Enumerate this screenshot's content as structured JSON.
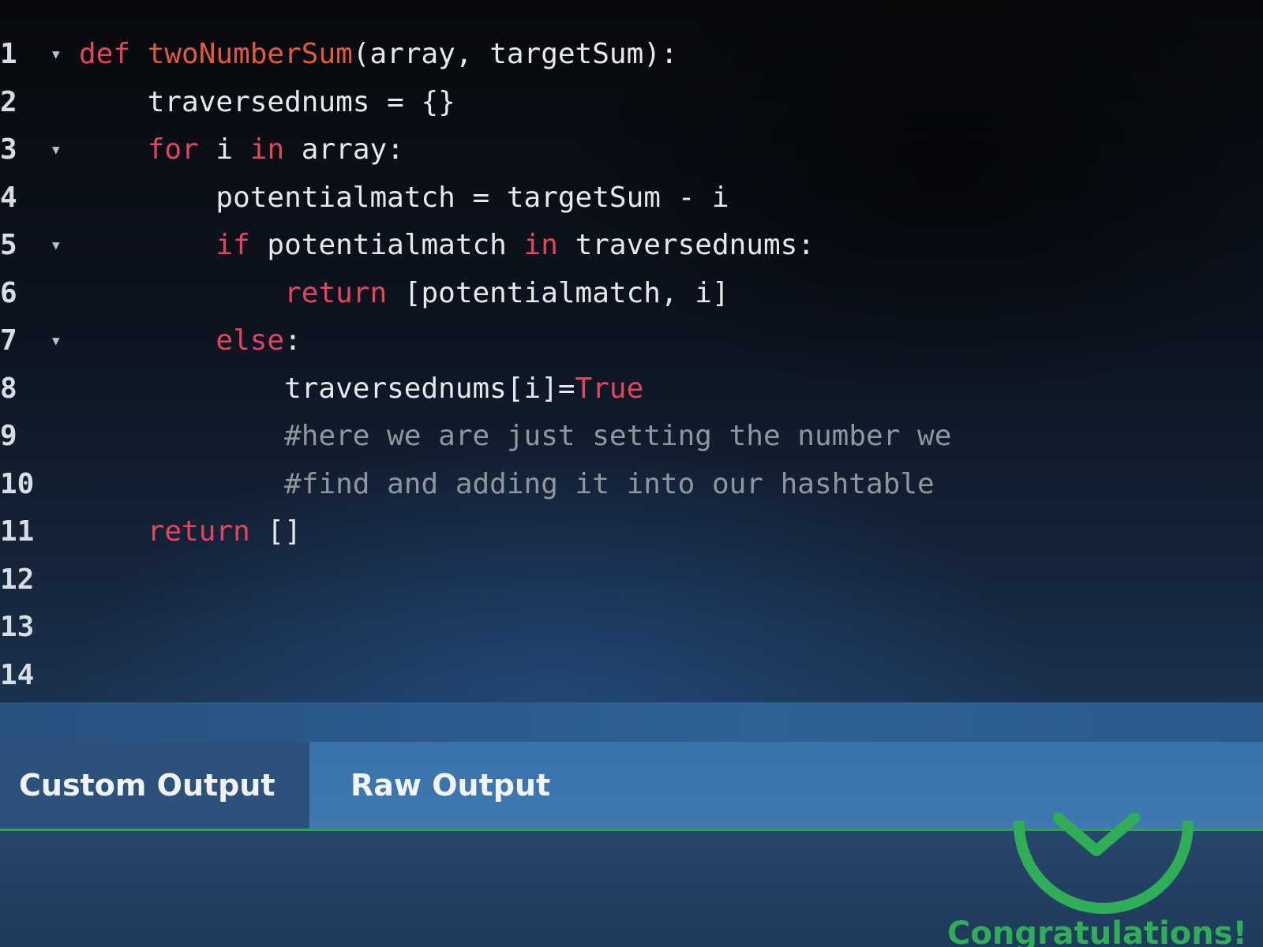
{
  "editor": {
    "lines": [
      {
        "num": "1",
        "fold": true,
        "segments": [
          [
            "def ",
            "kw"
          ],
          [
            "twoNumberSum",
            "fn"
          ],
          [
            "(array, targetSum):",
            ""
          ]
        ]
      },
      {
        "num": "2",
        "fold": false,
        "segments": [
          [
            "    traversednums = {}",
            ""
          ]
        ]
      },
      {
        "num": "3",
        "fold": true,
        "segments": [
          [
            "    ",
            ""
          ],
          [
            "for",
            "kw"
          ],
          [
            " i ",
            ""
          ],
          [
            "in",
            "kw"
          ],
          [
            " array:",
            ""
          ]
        ]
      },
      {
        "num": "4",
        "fold": false,
        "segments": [
          [
            "        potentialmatch = targetSum - i",
            ""
          ]
        ]
      },
      {
        "num": "5",
        "fold": true,
        "segments": [
          [
            "        ",
            ""
          ],
          [
            "if",
            "kw"
          ],
          [
            " potentialmatch ",
            ""
          ],
          [
            "in",
            "kw"
          ],
          [
            " traversednums:",
            ""
          ]
        ]
      },
      {
        "num": "6",
        "fold": false,
        "segments": [
          [
            "            ",
            ""
          ],
          [
            "return",
            "kw"
          ],
          [
            " [potentialmatch, i]",
            ""
          ]
        ]
      },
      {
        "num": "7",
        "fold": true,
        "segments": [
          [
            "        ",
            ""
          ],
          [
            "else",
            "kw"
          ],
          [
            ":",
            ""
          ]
        ]
      },
      {
        "num": "8",
        "fold": false,
        "segments": [
          [
            "            traversednums[i]=",
            ""
          ],
          [
            "True",
            "const"
          ]
        ]
      },
      {
        "num": "9",
        "fold": false,
        "segments": [
          [
            "            ",
            ""
          ],
          [
            "#here we are just setting the number we",
            "cmt"
          ]
        ]
      },
      {
        "num": "10",
        "fold": false,
        "segments": [
          [
            "            ",
            ""
          ],
          [
            "#find and adding it into our hashtable",
            "cmt"
          ]
        ]
      },
      {
        "num": "11",
        "fold": false,
        "segments": [
          [
            "    ",
            ""
          ],
          [
            "return",
            "kw"
          ],
          [
            " []",
            ""
          ]
        ]
      },
      {
        "num": "12",
        "fold": false,
        "segments": []
      },
      {
        "num": "13",
        "fold": false,
        "segments": []
      },
      {
        "num": "14",
        "fold": false,
        "segments": []
      }
    ]
  },
  "output_tabs": {
    "custom": "Custom Output",
    "raw": "Raw Output"
  },
  "result": {
    "message": "Congratulations!"
  },
  "colors": {
    "keyword": "#e2455d",
    "function": "#e05a3f",
    "comment": "#8f969c",
    "success": "#2fae57"
  },
  "icons": {
    "fold": "fold-arrow-icon",
    "success": "success-check-icon"
  }
}
